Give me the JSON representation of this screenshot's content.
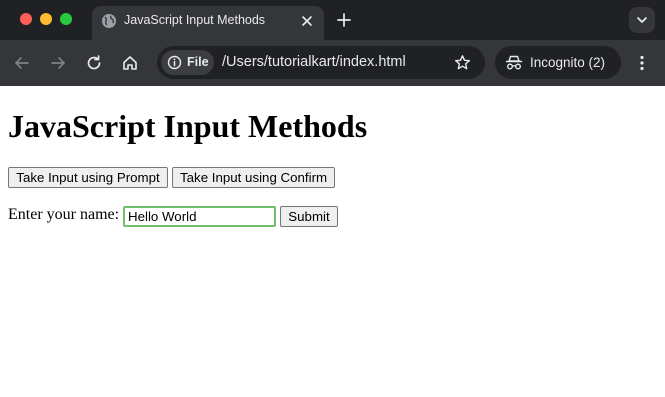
{
  "browser": {
    "tab": {
      "title": "JavaScript Input Methods",
      "favicon": "globe-icon"
    },
    "address_bar": {
      "chip_label": "File",
      "url": "/Users/tutorialkart/index.html"
    },
    "profile": {
      "label": "Incognito (2)"
    },
    "colors": {
      "frame": "#202124",
      "toolbar": "#35363a",
      "text": "#e8eaed"
    }
  },
  "page": {
    "heading": "JavaScript Input Methods",
    "buttons": {
      "prompt_label": "Take Input using Prompt",
      "confirm_label": "Take Input using Confirm"
    },
    "form": {
      "label": "Enter your name:",
      "input_value": "Hello World",
      "submit_label": "Submit"
    }
  }
}
